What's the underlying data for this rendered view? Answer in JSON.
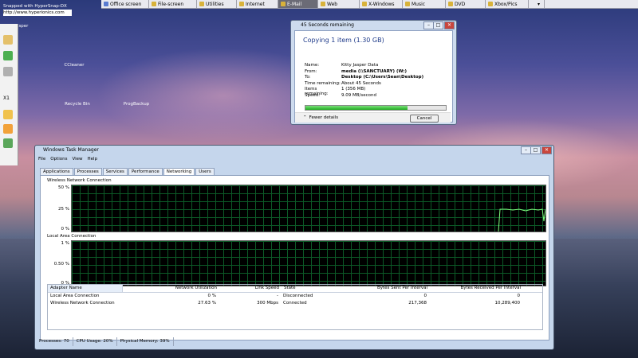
{
  "snap_banner": {
    "line1": "Snapped with HyperSnap-DX",
    "line2": "http://www.hyperionics.com"
  },
  "toolbar": [
    {
      "label": "Office screen",
      "color": "#5a7bd0"
    },
    {
      "label": "File-screen",
      "color": "#d8b23a"
    },
    {
      "label": "Utilities",
      "color": "#d8b23a"
    },
    {
      "label": "Internet",
      "color": "#d8b23a"
    },
    {
      "label": "E-Mail",
      "color": "#d8b23a",
      "active": true
    },
    {
      "label": "Web",
      "color": "#d8b23a"
    },
    {
      "label": "X-Windows",
      "color": "#d8b23a"
    },
    {
      "label": "Music",
      "color": "#d8b23a"
    },
    {
      "label": "DVD",
      "color": "#d8b23a"
    },
    {
      "label": "Xbox/Pics",
      "color": "#d8b23a"
    },
    {
      "label": "▾",
      "color": "#e9e9ef"
    }
  ],
  "desktop": {
    "user_label": "Kitty Jasper",
    "x1_label": "X1",
    "icons": [
      {
        "label": "CCleaner",
        "color": "#d23a2b"
      },
      {
        "label": "Recycle Bin",
        "color": "#c9d3de"
      },
      {
        "label": "ProgBackup",
        "color": "#f4f4f4"
      },
      {
        "label": "",
        "color": "#2a7de2"
      },
      {
        "label": "",
        "color": "#5b4038"
      },
      {
        "label": "",
        "color": "#6a86b7"
      },
      {
        "label": "",
        "color": "#3aa0c8"
      }
    ]
  },
  "copy_dialog": {
    "title": "45 Seconds remaining",
    "heading": "Copying 1 item (1.30 GB)",
    "fields": [
      {
        "key": "Name:",
        "value": "Kitty Jasper Data"
      },
      {
        "key": "From:",
        "value": "media (\\\\SANCTUARY) (W:)"
      },
      {
        "key": "To:",
        "value": "Desktop (C:\\Users\\Sean\\Desktop)"
      },
      {
        "key": "Time remaining:",
        "value": "About 45 Seconds"
      },
      {
        "key": "Items remaining:",
        "value": "1 (356 MB)"
      },
      {
        "key": "Speed:",
        "value": "9.09 MB/second"
      }
    ],
    "progress": 0.73,
    "fewer_details": "Fewer details",
    "cancel": "Cancel"
  },
  "task_manager": {
    "title": "Windows Task Manager",
    "menu": [
      "File",
      "Options",
      "View",
      "Help"
    ],
    "tabs": [
      "Applications",
      "Processes",
      "Services",
      "Performance",
      "Networking",
      "Users"
    ],
    "selected_tab": "Networking",
    "graphs": [
      {
        "title": "Wireless Network Connection",
        "ticks": [
          "50 %",
          "25 %",
          "0 %"
        ]
      },
      {
        "title": "Local Area Connection",
        "ticks": [
          "1 %",
          "0.50 %",
          "0 %"
        ]
      }
    ],
    "columns": [
      "Adapter Name",
      "Network Utilization",
      "Link Speed",
      "State",
      "Bytes Sent Per Interval",
      "Bytes Received Per Interval"
    ],
    "rows": [
      [
        "Local Area Connection",
        "0 %",
        "-",
        "Disconnected",
        "0",
        "0"
      ],
      [
        "Wireless Network Connection",
        "27.63 %",
        "300 Mbps",
        "Connected",
        "217,368",
        "10,289,400"
      ]
    ],
    "status": [
      "Processes: 70",
      "CPU Usage: 20%",
      "Physical Memory: 39%"
    ]
  }
}
